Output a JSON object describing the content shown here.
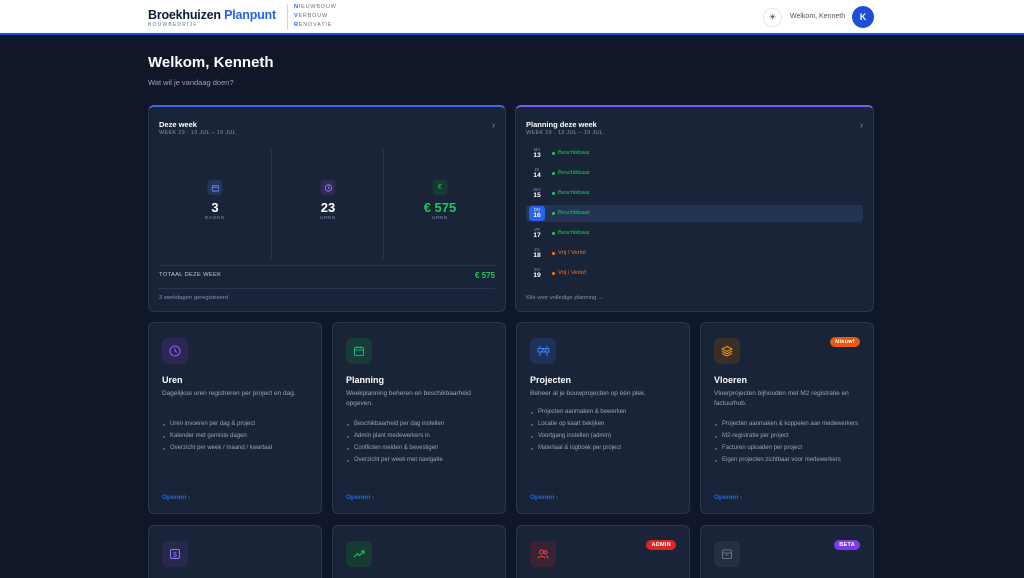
{
  "header": {
    "brand_main": "Broekhuizen",
    "brand_accent": "Planpunt",
    "brand_sub": "BOUWBEDRIJF",
    "tags": [
      {
        "first": "N",
        "rest": "IEUWBOUW"
      },
      {
        "first": "V",
        "rest": "ERBOUW"
      },
      {
        "first": "R",
        "rest": "ENOVATIE"
      }
    ],
    "theme_icon": "sun-icon",
    "welcome_text": "Welkom, Kenneth",
    "avatar_initial": "K"
  },
  "page": {
    "title": "Welkom, Kenneth",
    "subtitle": "Wat wil je vandaag doen?"
  },
  "week_card": {
    "title": "Deze week",
    "subtitle": "WEEK 29 · 13 JUL – 19 JUL",
    "stats": [
      {
        "icon": "calendar-icon",
        "value": "3",
        "label": "DAGEN",
        "color": "#6d8df5",
        "bg": "#24355c"
      },
      {
        "icon": "clock-icon",
        "value": "23",
        "label": "UREN",
        "color": "#a78bfa",
        "bg": "#302a55"
      },
      {
        "icon": "euro-icon",
        "value": "€ 575",
        "label": "UREN",
        "color": "#22c55e",
        "bg": "#173b34"
      }
    ],
    "total_label": "TOTAAL DEZE WEEK",
    "total_value": "€ 575",
    "footer": "3 werkdagen geregistreerd"
  },
  "planning_card": {
    "title": "Planning deze week",
    "subtitle": "WEEK 29 · 13 JUL – 19 JUL",
    "days": [
      {
        "name": "MA",
        "num": "13",
        "status": "Beschikbaar",
        "color": "#22c55e",
        "active": false
      },
      {
        "name": "DI",
        "num": "14",
        "status": "Beschikbaar",
        "color": "#22c55e",
        "active": false
      },
      {
        "name": "WO",
        "num": "15",
        "status": "Beschikbaar",
        "color": "#22c55e",
        "active": false
      },
      {
        "name": "DO",
        "num": "16",
        "status": "Beschikbaar",
        "color": "#22c55e",
        "active": true
      },
      {
        "name": "VR",
        "num": "17",
        "status": "Beschikbaar",
        "color": "#22c55e",
        "active": false
      },
      {
        "name": "ZA",
        "num": "18",
        "status": "Vrij / Verlof",
        "color": "#f97316",
        "active": false
      },
      {
        "name": "ZO",
        "num": "19",
        "status": "Vrij / Verlof",
        "color": "#f97316",
        "active": false
      }
    ],
    "footer": "Klik voor volledige planning →"
  },
  "modules": [
    {
      "key": "uren",
      "icon": "clock-icon",
      "color": "#8b5cf6",
      "bg": "#2c2652",
      "title": "Uren",
      "desc": "Dagelijkse uren registreren per project en dag.",
      "items": [
        "Uren invoeren per dag & project",
        "Kalender met gemiste dagen",
        "Overzicht per week / maand / kwartaal"
      ],
      "open": "Openen",
      "badge": ""
    },
    {
      "key": "planning",
      "icon": "calendar-icon",
      "color": "#10b981",
      "bg": "#173b37",
      "title": "Planning",
      "desc": "Weekplanning beheren en beschikbaarheid opgeven.",
      "items": [
        "Beschikbaarheid per dag instellen",
        "Admin plant medewerkers in",
        "Conflicten melden & bevestigen",
        "Overzicht per week met navigatie"
      ],
      "open": "Openen",
      "badge": ""
    },
    {
      "key": "projecten",
      "icon": "barrier-icon",
      "color": "#3b82f6",
      "bg": "#1f3157",
      "title": "Projecten",
      "desc": "Beheer al je bouwprojecten op één plek.",
      "items": [
        "Projecten aanmaken & bewerken",
        "Locatie op kaart bekijken",
        "Voortgang instellen (admin)",
        "Materiaal & logboek per project"
      ],
      "open": "Openen",
      "badge": ""
    },
    {
      "key": "vloeren",
      "icon": "layers-icon",
      "color": "#f59e0b",
      "bg": "#3a2f26",
      "title": "Vloeren",
      "desc": "Vloerprojecten bijhouden met M2 registratie en factuurhub.",
      "items": [
        "Projecten aanmaken & koppelen aan medewerkers",
        "M2-registratie per project",
        "Facturen uploaden per project",
        "Eigen projecten zichtbaar voor medewerkers"
      ],
      "open": "Openen",
      "badge": "Nieuw!",
      "badge_color": "#ea580c"
    }
  ],
  "modules_row2": [
    {
      "icon": "dollar-icon",
      "color": "#8b7cf6",
      "bg": "#28284f",
      "badge": ""
    },
    {
      "icon": "trending-up-icon",
      "color": "#22c55e",
      "bg": "#173b34",
      "badge": ""
    },
    {
      "icon": "users-icon",
      "color": "#ef4444",
      "bg": "#3a2330",
      "badge": "ADMIN",
      "badge_color": "#dc2626"
    },
    {
      "icon": "archive-icon",
      "color": "#6b7280",
      "bg": "#262f42",
      "badge": "BETA",
      "badge_color": "#7c3aed"
    }
  ]
}
